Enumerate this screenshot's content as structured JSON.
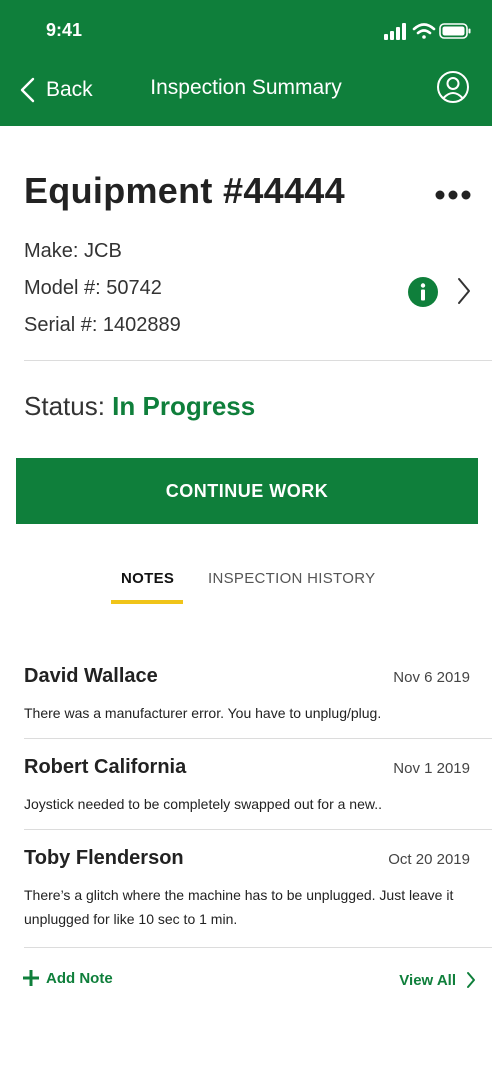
{
  "status_bar": {
    "time": "9:41"
  },
  "nav": {
    "back_label": "Back",
    "title": "Inspection Summary"
  },
  "equipment": {
    "title": "Equipment #44444",
    "make": "Make: JCB",
    "model": "Model #: 50742",
    "serial": "Serial #: 1402889"
  },
  "status": {
    "label": "Status:",
    "value": "In Progress"
  },
  "cta": {
    "label": "CONTINUE WORK"
  },
  "tabs": [
    {
      "label": "NOTES",
      "active": true
    },
    {
      "label": "INSPECTION HISTORY",
      "active": false
    }
  ],
  "notes": [
    {
      "author": "David Wallace",
      "date": "Nov 6 2019",
      "text": "There was a manufacturer error. You have to unplug/plug."
    },
    {
      "author": "Robert California",
      "date": "Nov 1 2019",
      "text": "Joystick needed to be completely swapped out for a new.."
    },
    {
      "author": "Toby Flenderson",
      "date": "Oct 20 2019",
      "text": "There’s a glitch where the machine has to be unplugged. Just leave it unplugged for like 10 sec to 1 min."
    }
  ],
  "footer": {
    "add_note": "Add Note",
    "view_all": "View All"
  },
  "colors": {
    "brand_green": "#0f7f3b",
    "tab_indicator": "#f0c419",
    "divider": "#dcdcdc"
  },
  "icons": {
    "back": "chevron-left-icon",
    "account": "user-circle-icon",
    "more": "more-horizontal-icon",
    "info": "info-icon",
    "detail": "chevron-right-icon",
    "add": "plus-icon",
    "view_all": "chevron-right-icon"
  }
}
